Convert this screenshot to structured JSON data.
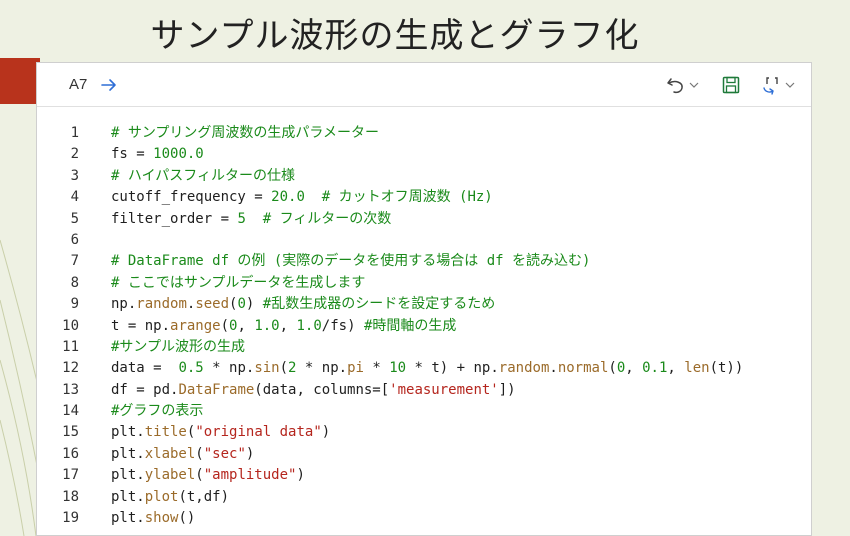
{
  "slide": {
    "title": "サンプル波形の生成とグラフ化"
  },
  "toolbar": {
    "cell_ref": "A7",
    "icons": [
      "arrow-right-icon",
      "undo-icon",
      "chevron-down-icon",
      "save-icon",
      "format-brackets-icon",
      "chevron-down-icon"
    ]
  },
  "colors": {
    "background": "#eef1e3",
    "accent": "#b8331c",
    "comment": "#1a8a1a",
    "string": "#b5261e",
    "function": "#9b6b2a",
    "link_blue": "#2f6fd6"
  },
  "code": {
    "lines": [
      {
        "n": "1",
        "tokens": [
          {
            "t": "# サンプリング周波数の生成パラメーター",
            "c": "cm"
          }
        ]
      },
      {
        "n": "2",
        "tokens": [
          {
            "t": "fs = ",
            "c": "kw"
          },
          {
            "t": "1000.0",
            "c": "num"
          }
        ]
      },
      {
        "n": "3",
        "tokens": [
          {
            "t": "# ハイパスフィルターの仕様",
            "c": "cm"
          }
        ]
      },
      {
        "n": "4",
        "tokens": [
          {
            "t": "cutoff_frequency = ",
            "c": "kw"
          },
          {
            "t": "20.0",
            "c": "num"
          },
          {
            "t": "  # カットオフ周波数 (Hz)",
            "c": "cm"
          }
        ]
      },
      {
        "n": "5",
        "tokens": [
          {
            "t": "filter_order = ",
            "c": "kw"
          },
          {
            "t": "5",
            "c": "num"
          },
          {
            "t": "  # フィルターの次数",
            "c": "cm"
          }
        ]
      },
      {
        "n": "6",
        "tokens": []
      },
      {
        "n": "7",
        "tokens": [
          {
            "t": "# DataFrame df の例 (実際のデータを使用する場合は df を読み込む)",
            "c": "cm"
          }
        ]
      },
      {
        "n": "8",
        "tokens": [
          {
            "t": "# ここではサンプルデータを生成します",
            "c": "cm"
          }
        ]
      },
      {
        "n": "9",
        "tokens": [
          {
            "t": "np.",
            "c": "kw"
          },
          {
            "t": "random",
            "c": "fn"
          },
          {
            "t": ".",
            "c": "kw"
          },
          {
            "t": "seed",
            "c": "fn"
          },
          {
            "t": "(",
            "c": "kw"
          },
          {
            "t": "0",
            "c": "num"
          },
          {
            "t": ") ",
            "c": "kw"
          },
          {
            "t": "#乱数生成器のシードを設定するため",
            "c": "cm"
          }
        ]
      },
      {
        "n": "10",
        "tokens": [
          {
            "t": "t = np.",
            "c": "kw"
          },
          {
            "t": "arange",
            "c": "fn"
          },
          {
            "t": "(",
            "c": "kw"
          },
          {
            "t": "0",
            "c": "num"
          },
          {
            "t": ", ",
            "c": "kw"
          },
          {
            "t": "1.0",
            "c": "num"
          },
          {
            "t": ", ",
            "c": "kw"
          },
          {
            "t": "1.0",
            "c": "num"
          },
          {
            "t": "/fs) ",
            "c": "kw"
          },
          {
            "t": "#時間軸の生成",
            "c": "cm"
          }
        ]
      },
      {
        "n": "11",
        "tokens": [
          {
            "t": "#サンプル波形の生成",
            "c": "cm"
          }
        ]
      },
      {
        "n": "12",
        "tokens": [
          {
            "t": "data =  ",
            "c": "kw"
          },
          {
            "t": "0.5",
            "c": "num"
          },
          {
            "t": " * np.",
            "c": "kw"
          },
          {
            "t": "sin",
            "c": "fn"
          },
          {
            "t": "(",
            "c": "kw"
          },
          {
            "t": "2",
            "c": "num"
          },
          {
            "t": " * np.",
            "c": "kw"
          },
          {
            "t": "pi",
            "c": "fn"
          },
          {
            "t": " * ",
            "c": "kw"
          },
          {
            "t": "10",
            "c": "num"
          },
          {
            "t": " * t) + np.",
            "c": "kw"
          },
          {
            "t": "random",
            "c": "fn"
          },
          {
            "t": ".",
            "c": "kw"
          },
          {
            "t": "normal",
            "c": "fn"
          },
          {
            "t": "(",
            "c": "kw"
          },
          {
            "t": "0",
            "c": "num"
          },
          {
            "t": ", ",
            "c": "kw"
          },
          {
            "t": "0.1",
            "c": "num"
          },
          {
            "t": ", ",
            "c": "kw"
          },
          {
            "t": "len",
            "c": "fn"
          },
          {
            "t": "(t))",
            "c": "kw"
          }
        ]
      },
      {
        "n": "13",
        "tokens": [
          {
            "t": "df = pd.",
            "c": "kw"
          },
          {
            "t": "DataFrame",
            "c": "fn"
          },
          {
            "t": "(data, columns=[",
            "c": "kw"
          },
          {
            "t": "'measurement'",
            "c": "str"
          },
          {
            "t": "])",
            "c": "kw"
          }
        ]
      },
      {
        "n": "14",
        "tokens": [
          {
            "t": "#グラフの表示",
            "c": "cm"
          }
        ]
      },
      {
        "n": "15",
        "tokens": [
          {
            "t": "plt.",
            "c": "kw"
          },
          {
            "t": "title",
            "c": "fn"
          },
          {
            "t": "(",
            "c": "kw"
          },
          {
            "t": "\"original data\"",
            "c": "str"
          },
          {
            "t": ")",
            "c": "kw"
          }
        ]
      },
      {
        "n": "16",
        "tokens": [
          {
            "t": "plt.",
            "c": "kw"
          },
          {
            "t": "xlabel",
            "c": "fn"
          },
          {
            "t": "(",
            "c": "kw"
          },
          {
            "t": "\"sec\"",
            "c": "str"
          },
          {
            "t": ")",
            "c": "kw"
          }
        ]
      },
      {
        "n": "17",
        "tokens": [
          {
            "t": "plt.",
            "c": "kw"
          },
          {
            "t": "ylabel",
            "c": "fn"
          },
          {
            "t": "(",
            "c": "kw"
          },
          {
            "t": "\"amplitude\"",
            "c": "str"
          },
          {
            "t": ")",
            "c": "kw"
          }
        ]
      },
      {
        "n": "18",
        "tokens": [
          {
            "t": "plt.",
            "c": "kw"
          },
          {
            "t": "plot",
            "c": "fn"
          },
          {
            "t": "(t,df)",
            "c": "kw"
          }
        ]
      },
      {
        "n": "19",
        "tokens": [
          {
            "t": "plt.",
            "c": "kw"
          },
          {
            "t": "show",
            "c": "fn"
          },
          {
            "t": "()",
            "c": "kw"
          }
        ]
      }
    ]
  }
}
